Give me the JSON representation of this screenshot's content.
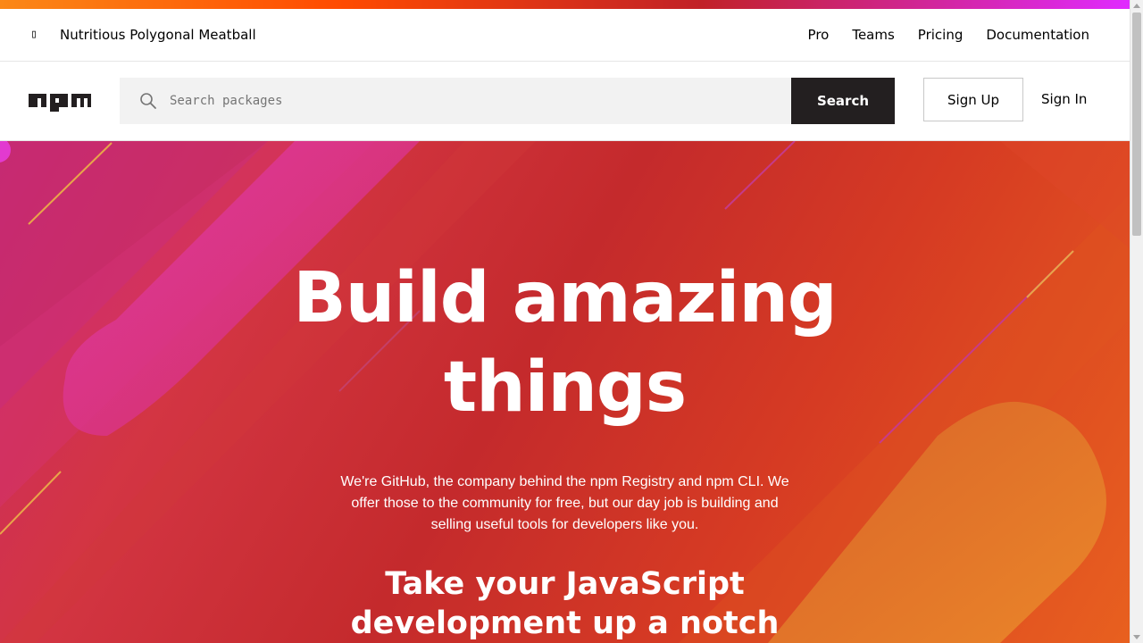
{
  "topnav": {
    "tagline": "Nutritious Polygonal Meatball",
    "links": [
      "Pro",
      "Teams",
      "Pricing",
      "Documentation"
    ]
  },
  "header": {
    "logo_icon": "npm-logo",
    "search": {
      "icon": "search-icon",
      "placeholder": "Search packages",
      "value": "",
      "button_label": "Search"
    },
    "signup_label": "Sign Up",
    "signin_label": "Sign In"
  },
  "hero": {
    "title_line1": "Build amazing",
    "title_line2": "things",
    "description": "We're GitHub, the company behind the npm Registry and npm CLI. We offer those to the community for free, but our day job is building and selling useful tools for developers like you.",
    "subtitle_line1": "Take your JavaScript",
    "subtitle_line2": "development up a notch"
  },
  "colors": {
    "accent_stripe": [
      "#fb8817",
      "#ff4b01",
      "#c12127",
      "#e02aff"
    ],
    "search_button_bg": "#231f20",
    "hero_gradient": [
      "#cb2a6a",
      "#c42a2c",
      "#e8601f"
    ]
  }
}
